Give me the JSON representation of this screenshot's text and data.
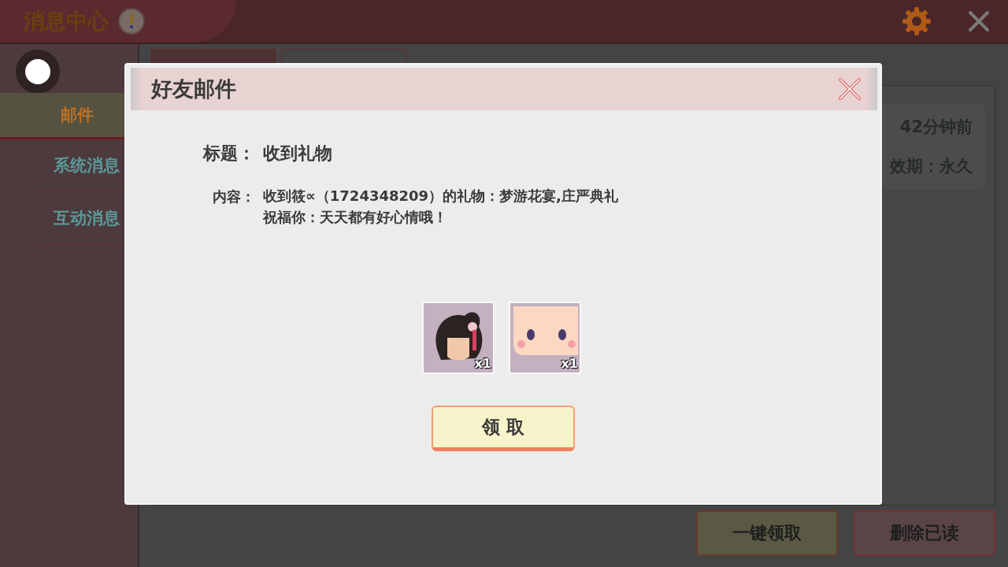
{
  "header": {
    "title": "消息中心"
  },
  "sidebar": {
    "items": [
      {
        "label": "邮件",
        "selected": true
      },
      {
        "label": "系统消息",
        "selected": false
      },
      {
        "label": "互动消息",
        "selected": false
      }
    ]
  },
  "tabs": [
    {
      "selected": true
    },
    {
      "selected": false
    }
  ],
  "mail_card": {
    "time": "42分钟前",
    "validity": "效期：永久"
  },
  "actions": [
    "一键领取",
    "删除已读"
  ],
  "dialog": {
    "title": "好友邮件",
    "subject_label": "标题：",
    "subject": "收到礼物",
    "content_label": "内容：",
    "content_lines": [
      "收到筱∝（1724348209）的礼物：梦游花宴,庄严典礼",
      "祝福你：天天都有好心情哦！"
    ],
    "items": [
      {
        "kind": "hair",
        "count": "x1"
      },
      {
        "kind": "face",
        "count": "x1"
      }
    ],
    "claim_button": "领 取"
  }
}
